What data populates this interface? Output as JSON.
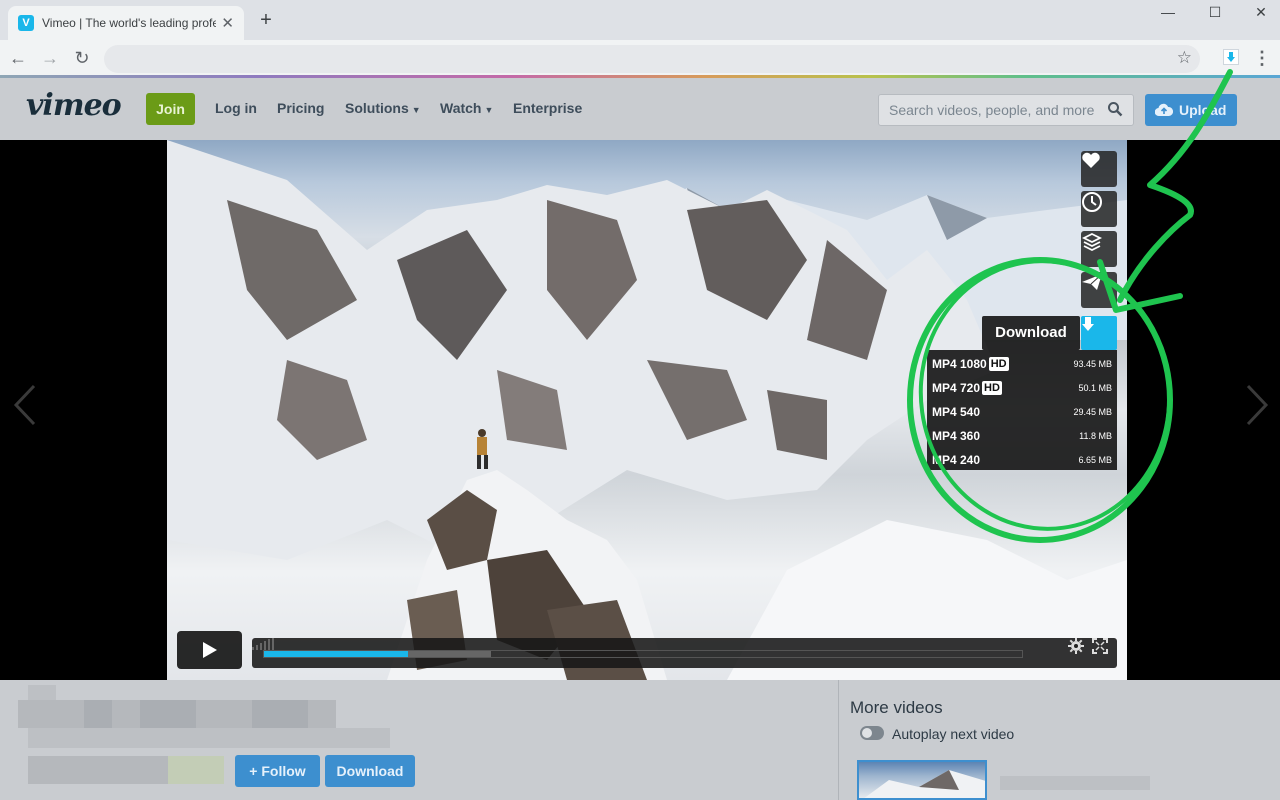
{
  "browser": {
    "tab_title": "Vimeo | The world's leading professional video platform",
    "tab_favicon": "V",
    "tab_close": "✕",
    "new_tab": "+",
    "window_controls": {
      "minimize": "—",
      "maximize": "☐",
      "close": "✕"
    }
  },
  "header": {
    "logo": "vimeo",
    "join": "Join",
    "login": "Log in",
    "pricing": "Pricing",
    "solutions": "Solutions",
    "watch": "Watch",
    "enterprise": "Enterprise",
    "search_placeholder": "Search videos, people, and more",
    "upload": "Upload"
  },
  "player": {
    "download_label": "Download",
    "progress": {
      "played": 0.19,
      "loaded": 0.3
    },
    "downloads": [
      {
        "format": "MP4 1080",
        "hd": "HD",
        "size": "93.45 MB"
      },
      {
        "format": "MP4 720",
        "hd": "HD",
        "size": "50.1 MB"
      },
      {
        "format": "MP4 540",
        "hd": "",
        "size": "29.45 MB"
      },
      {
        "format": "MP4 360",
        "hd": "",
        "size": "11.8 MB"
      },
      {
        "format": "MP4 240",
        "hd": "",
        "size": "6.65 MB"
      }
    ]
  },
  "below": {
    "follow": "+ Follow",
    "download": "Download",
    "more_videos": "More videos",
    "autoplay": "Autoplay next video"
  },
  "colors": {
    "vimeo_blue": "#1ab7ea",
    "join_green": "#6b9b17",
    "button_blue": "#3d8fcf",
    "annotation_green": "#1fc44f"
  },
  "icons": [
    "heart-icon",
    "clock-icon",
    "layers-icon",
    "paper-plane-icon",
    "download-arrow-icon",
    "play-icon",
    "settings-gear-icon",
    "fullscreen-icon",
    "search-icon",
    "cloud-upload-icon"
  ]
}
